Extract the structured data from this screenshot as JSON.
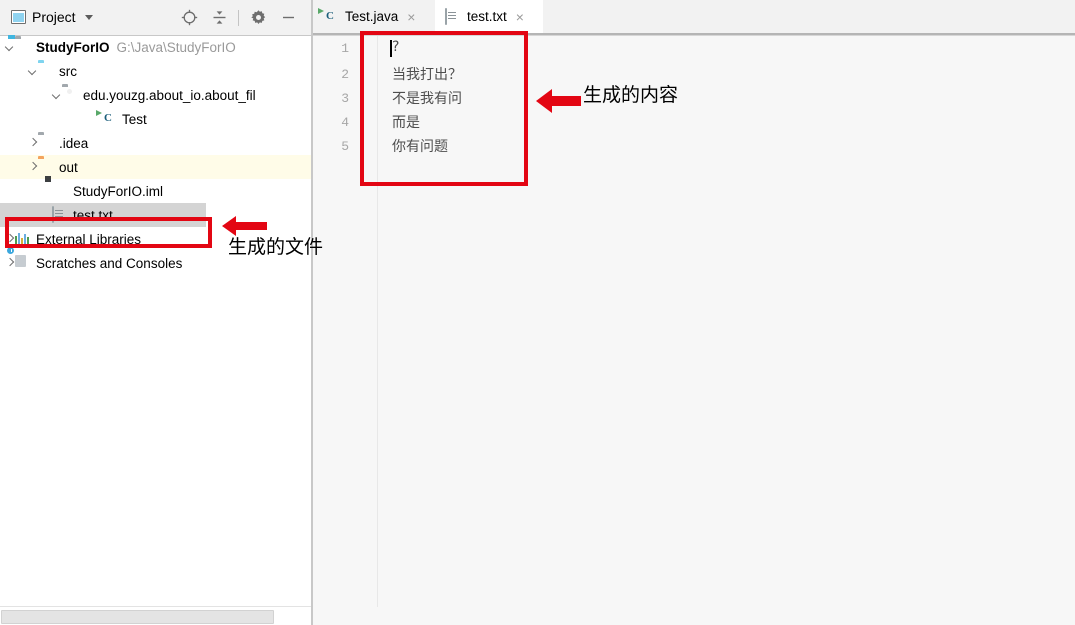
{
  "toolbar": {
    "project_label": "Project",
    "icons": [
      {
        "name": "locate-icon",
        "glyph": "target"
      },
      {
        "name": "collapse-all-icon",
        "glyph": "collapse"
      },
      {
        "name": "settings-gear-icon",
        "glyph": "gear"
      },
      {
        "name": "hide-panel-icon",
        "glyph": "minus"
      }
    ]
  },
  "tree": {
    "items": [
      {
        "label": "StudyForIO",
        "path": "G:\\Java\\StudyForIO",
        "icon": "module-folder-icon",
        "indent": 0,
        "arrow": "down",
        "bold": true,
        "state": "normal"
      },
      {
        "label": "src",
        "path": "",
        "icon": "source-folder-icon",
        "indent": 1,
        "arrow": "down",
        "bold": false,
        "state": "normal"
      },
      {
        "label": "edu.youzg.about_io.about_fil",
        "path": "",
        "icon": "package-folder-icon",
        "indent": 2,
        "arrow": "down",
        "bold": false,
        "state": "normal"
      },
      {
        "label": "Test",
        "path": "",
        "icon": "java-class-icon",
        "indent": 3,
        "arrow": "none",
        "bold": false,
        "state": "normal"
      },
      {
        "label": ".idea",
        "path": "",
        "icon": "folder-icon",
        "indent": 1,
        "arrow": "right",
        "bold": false,
        "state": "normal"
      },
      {
        "label": "out",
        "path": "",
        "icon": "excluded-folder-icon",
        "indent": 1,
        "arrow": "right",
        "bold": false,
        "state": "excluded"
      },
      {
        "label": "StudyForIO.iml",
        "path": "",
        "icon": "iml-file-icon",
        "indent": 2,
        "arrow": "none",
        "bold": false,
        "state": "normal"
      },
      {
        "label": "test.txt",
        "path": "",
        "icon": "text-file-icon",
        "indent": 2,
        "arrow": "none",
        "bold": false,
        "state": "selected"
      },
      {
        "label": "External Libraries",
        "path": "",
        "icon": "libraries-icon",
        "indent": 0,
        "arrow": "right",
        "bold": false,
        "state": "normal"
      },
      {
        "label": "Scratches and Consoles",
        "path": "",
        "icon": "scratches-icon",
        "indent": 0,
        "arrow": "right",
        "bold": false,
        "state": "normal"
      }
    ]
  },
  "editor": {
    "tabs": [
      {
        "label": "Test.java",
        "icon": "java-class-icon",
        "active": false,
        "close": "×"
      },
      {
        "label": "test.txt",
        "icon": "text-file-icon",
        "active": true,
        "close": "×"
      }
    ],
    "line_numbers": [
      "1",
      "2",
      "3",
      "4",
      "5"
    ],
    "lines": [
      "?",
      "当我打出？",
      "不是我有问",
      "而是",
      "你有问题"
    ],
    "current_line": 1
  },
  "annotations": [
    {
      "name": "editor-content-annotation",
      "text": "生成的内容"
    },
    {
      "name": "generated-file-annotation",
      "text": "生成的文件"
    }
  ],
  "colors": {
    "annotation_red": "#e30613",
    "current_line": "#e0e0f8",
    "excluded_row": "#fffce8",
    "selected_row": "#d4d4d4"
  }
}
